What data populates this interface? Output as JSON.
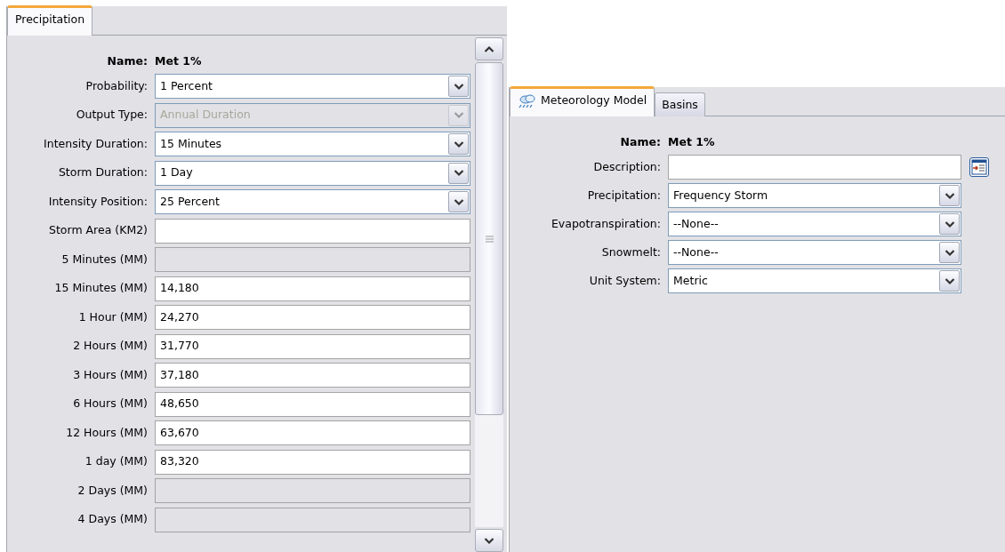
{
  "left_panel": {
    "tabs": [
      {
        "label": "Precipitation",
        "selected": true
      }
    ],
    "name": {
      "label": "Name:",
      "value": "Met 1%"
    },
    "fields": [
      {
        "kind": "select",
        "label": "Probability:",
        "value": "1 Percent",
        "disabled": false
      },
      {
        "kind": "select",
        "label": "Output Type:",
        "value": "Annual Duration",
        "disabled": true
      },
      {
        "kind": "select",
        "label": "Intensity Duration:",
        "value": "15 Minutes",
        "disabled": false
      },
      {
        "kind": "select",
        "label": "Storm Duration:",
        "value": "1 Day",
        "disabled": false
      },
      {
        "kind": "select",
        "label": "Intensity Position:",
        "value": "25 Percent",
        "disabled": false
      },
      {
        "kind": "text",
        "label": "Storm Area (KM2)",
        "disabled": false
      },
      {
        "kind": "text",
        "label": "5 Minutes (MM)",
        "disabled": true
      },
      {
        "kind": "text",
        "label": "15 Minutes (MM)",
        "value": "14,180",
        "disabled": false
      },
      {
        "kind": "text",
        "label": "1 Hour (MM)",
        "value": "24,270",
        "disabled": false
      },
      {
        "kind": "text",
        "label": "2 Hours (MM)",
        "value": "31,770",
        "disabled": false
      },
      {
        "kind": "text",
        "label": "3 Hours (MM)",
        "value": "37,180",
        "disabled": false
      },
      {
        "kind": "text",
        "label": "6 Hours (MM)",
        "value": "48,650",
        "disabled": false
      },
      {
        "kind": "text",
        "label": "12 Hours (MM)",
        "value": "63,670",
        "disabled": false
      },
      {
        "kind": "text",
        "label": "1 day (MM)",
        "value": "83,320",
        "disabled": false
      },
      {
        "kind": "text",
        "label": "2 Days (MM)",
        "disabled": true
      },
      {
        "kind": "text",
        "label": "4 Days (MM)",
        "disabled": true
      }
    ]
  },
  "right_panel": {
    "tabs": [
      {
        "label": "Meteorology Model",
        "selected": true,
        "icon": true
      },
      {
        "label": "Basins",
        "selected": false
      }
    ],
    "name": {
      "label": "Name:",
      "value": "Met 1%"
    },
    "fields": [
      {
        "kind": "text",
        "label": "Description:",
        "disabled": false,
        "button": true
      },
      {
        "kind": "select",
        "label": "Precipitation:",
        "value": "Frequency Storm",
        "disabled": false
      },
      {
        "kind": "select",
        "label": "Evapotranspiration:",
        "value": "--None--",
        "disabled": false
      },
      {
        "kind": "select",
        "label": "Snowmelt:",
        "value": "--None--",
        "disabled": false
      },
      {
        "kind": "select",
        "label": "Unit System:",
        "value": "Metric",
        "disabled": false
      }
    ]
  }
}
